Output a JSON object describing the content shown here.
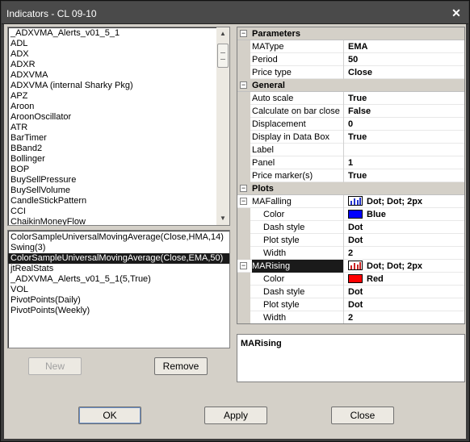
{
  "window": {
    "title": "Indicators - CL 09-10"
  },
  "indicator_list": {
    "items": [
      "_ADXVMA_Alerts_v01_5_1",
      "ADL",
      "ADX",
      "ADXR",
      "ADXVMA",
      "ADXVMA (internal Sharky Pkg)",
      "APZ",
      "Aroon",
      "AroonOscillator",
      "ATR",
      "BarTimer",
      "BBand2",
      "Bollinger",
      "BOP",
      "BuySellPressure",
      "BuySellVolume",
      "CandleStickPattern",
      "CCI",
      "ChaikinMoneyFlow"
    ]
  },
  "applied_list": {
    "items": [
      "ColorSampleUniversalMovingAverage(Close,HMA,14)",
      "Swing(3)",
      "ColorSampleUniversalMovingAverage(Close,EMA,50)",
      "jtRealStats",
      "_ADXVMA_Alerts_v01_5_1(5,True)",
      "VOL",
      "PivotPoints(Daily)",
      "PivotPoints(Weekly)"
    ],
    "selected_index": 2
  },
  "buttons": {
    "new": "New",
    "remove": "Remove",
    "ok": "OK",
    "apply": "Apply",
    "close": "Close"
  },
  "properties": {
    "parameters": {
      "label": "Parameters",
      "matype": {
        "name": "MAType",
        "value": "EMA"
      },
      "period": {
        "name": "Period",
        "value": "50"
      },
      "price_type": {
        "name": "Price type",
        "value": "Close"
      }
    },
    "general": {
      "label": "General",
      "auto_scale": {
        "name": "Auto scale",
        "value": "True"
      },
      "calc_on_bar_close": {
        "name": "Calculate on bar close",
        "value": "False"
      },
      "displacement": {
        "name": "Displacement",
        "value": "0"
      },
      "display_in_data_box": {
        "name": "Display in Data Box",
        "value": "True"
      },
      "label_prop": {
        "name": "Label",
        "value": ""
      },
      "panel": {
        "name": "Panel",
        "value": "1"
      },
      "price_markers": {
        "name": "Price marker(s)",
        "value": "True"
      }
    },
    "plots": {
      "label": "Plots",
      "mafalling": {
        "name": "MAFalling",
        "value": "Dot; Dot; 2px",
        "icon_color": "#2233cc",
        "color": {
          "name": "Color",
          "value": "Blue",
          "hex": "#0000ff"
        },
        "dash_style": {
          "name": "Dash style",
          "value": "Dot"
        },
        "plot_style": {
          "name": "Plot style",
          "value": "Dot"
        },
        "width": {
          "name": "Width",
          "value": "2"
        }
      },
      "marising": {
        "name": "MARising",
        "value": "Dot; Dot; 2px",
        "icon_color": "#cc2222",
        "color": {
          "name": "Color",
          "value": "Red",
          "hex": "#ff0000"
        },
        "dash_style": {
          "name": "Dash style",
          "value": "Dot"
        },
        "plot_style": {
          "name": "Plot style",
          "value": "Dot"
        },
        "width": {
          "name": "Width",
          "value": "2"
        }
      }
    }
  },
  "description": {
    "title": "MARising"
  },
  "icons": {
    "close": "close-icon",
    "expand": "collapse-icon"
  }
}
